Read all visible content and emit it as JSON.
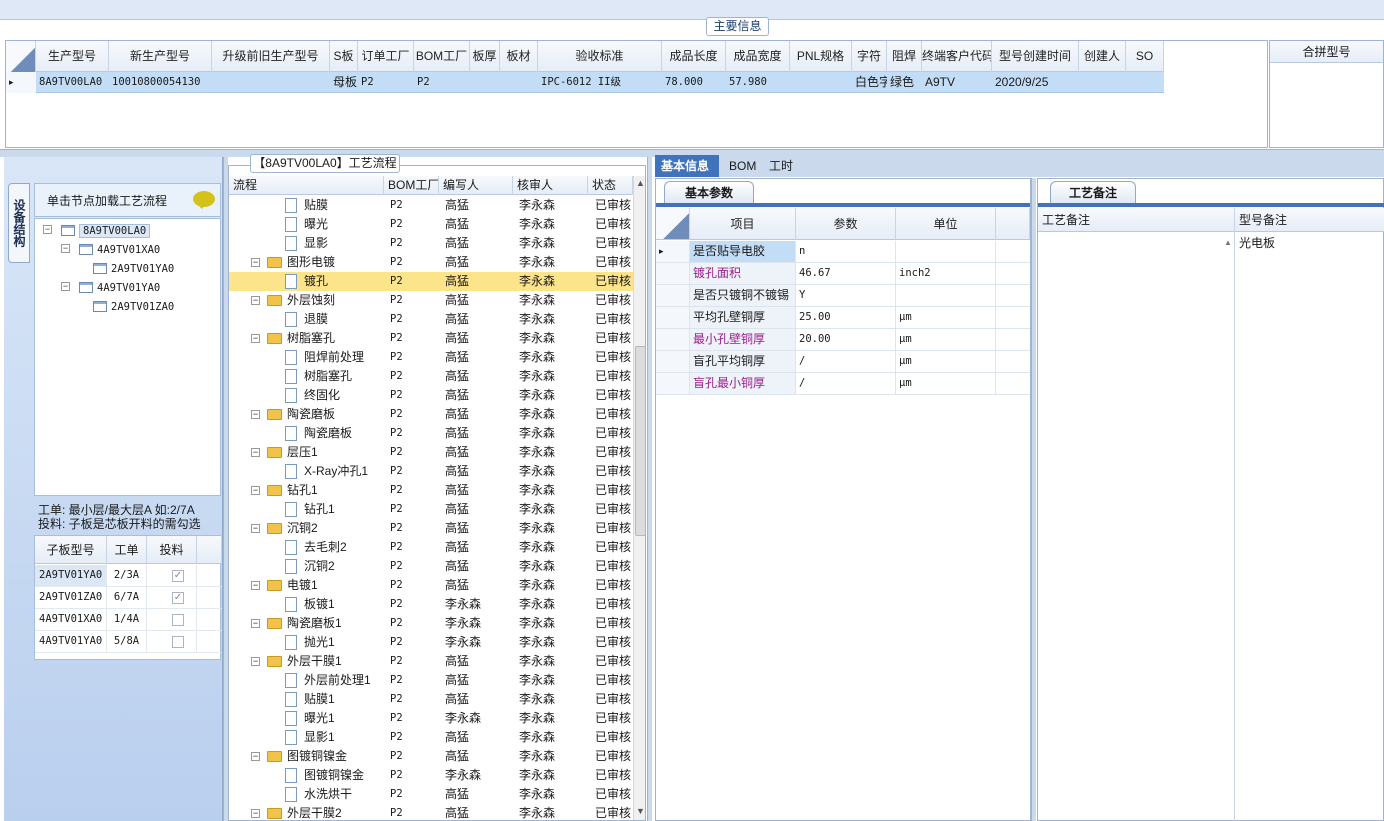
{
  "main": {
    "title": "主要信息",
    "columns": [
      "生产型号",
      "新生产型号",
      "升级前旧生产型号",
      "S板",
      "订单工厂",
      "BOM工厂",
      "板厚",
      "板材",
      "验收标准",
      "成品长度",
      "成品宽度",
      "PNL规格",
      "字符",
      "阻焊",
      "终端客户代码",
      "型号创建时间",
      "创建人",
      "SO"
    ],
    "row": [
      "8A9TV00LA0",
      "10010800054130",
      "",
      "母板",
      "P2",
      "P2",
      "",
      "",
      "IPC-6012 II级",
      "78.000",
      "57.980",
      "",
      "白色字符",
      "绿色",
      "A9TV",
      "2020/9/25",
      "",
      ""
    ],
    "row_marker": "▸",
    "merge_header": "合拼型号"
  },
  "left": {
    "vtab_label": "设备结构",
    "hint": "单击节点加载工艺流程",
    "tree": [
      {
        "label": "8A9TV00LA0",
        "level": 0
      },
      {
        "label": "4A9TV01XA0",
        "level": 1
      },
      {
        "label": "2A9TV01YA0",
        "level": 2
      },
      {
        "label": "4A9TV01YA0",
        "level": 1
      },
      {
        "label": "2A9TV01ZA0",
        "level": 2
      }
    ],
    "note_line1": "工单: 最小层/最大层A 如:2/7A",
    "note_line2": "投料: 子板是芯板开料的需勾选",
    "subgrid": {
      "headers": [
        "子板型号",
        "工单",
        "投料"
      ],
      "rows": [
        {
          "model": "2A9TV01YA0",
          "order": "2/3A",
          "checked": true
        },
        {
          "model": "2A9TV01ZA0",
          "order": "6/7A",
          "checked": true
        },
        {
          "model": "4A9TV01XA0",
          "order": "1/4A",
          "checked": false
        },
        {
          "model": "4A9TV01YA0",
          "order": "5/8A",
          "checked": false
        }
      ]
    }
  },
  "process": {
    "title": "【8A9TV00LA0】工艺流程",
    "headers": [
      "流程",
      "BOM工厂",
      "编写人",
      "核审人",
      "状态"
    ],
    "rows": [
      {
        "name": "贴膜",
        "level": 2,
        "bom": "P2",
        "writer": "高猛",
        "reviewer": "李永森",
        "status": "已审核"
      },
      {
        "name": "曝光",
        "level": 2,
        "bom": "P2",
        "writer": "高猛",
        "reviewer": "李永森",
        "status": "已审核"
      },
      {
        "name": "显影",
        "level": 2,
        "bom": "P2",
        "writer": "高猛",
        "reviewer": "李永森",
        "status": "已审核"
      },
      {
        "name": "图形电镀",
        "level": 1,
        "bom": "P2",
        "writer": "高猛",
        "reviewer": "李永森",
        "status": "已审核"
      },
      {
        "name": "镀孔",
        "level": 2,
        "bom": "P2",
        "writer": "高猛",
        "reviewer": "李永森",
        "status": "已审核",
        "selected": true
      },
      {
        "name": "外层蚀刻",
        "level": 1,
        "bom": "P2",
        "writer": "高猛",
        "reviewer": "李永森",
        "status": "已审核"
      },
      {
        "name": "退膜",
        "level": 2,
        "bom": "P2",
        "writer": "高猛",
        "reviewer": "李永森",
        "status": "已审核"
      },
      {
        "name": "树脂塞孔",
        "level": 1,
        "bom": "P2",
        "writer": "高猛",
        "reviewer": "李永森",
        "status": "已审核"
      },
      {
        "name": "阻焊前处理",
        "level": 2,
        "bom": "P2",
        "writer": "高猛",
        "reviewer": "李永森",
        "status": "已审核"
      },
      {
        "name": "树脂塞孔",
        "level": 2,
        "bom": "P2",
        "writer": "高猛",
        "reviewer": "李永森",
        "status": "已审核"
      },
      {
        "name": "终固化",
        "level": 2,
        "bom": "P2",
        "writer": "高猛",
        "reviewer": "李永森",
        "status": "已审核"
      },
      {
        "name": "陶瓷磨板",
        "level": 1,
        "bom": "P2",
        "writer": "高猛",
        "reviewer": "李永森",
        "status": "已审核"
      },
      {
        "name": "陶瓷磨板",
        "level": 2,
        "bom": "P2",
        "writer": "高猛",
        "reviewer": "李永森",
        "status": "已审核"
      },
      {
        "name": "层压1",
        "level": 1,
        "bom": "P2",
        "writer": "高猛",
        "reviewer": "李永森",
        "status": "已审核"
      },
      {
        "name": "X-Ray冲孔1",
        "level": 2,
        "bom": "P2",
        "writer": "高猛",
        "reviewer": "李永森",
        "status": "已审核"
      },
      {
        "name": "钻孔1",
        "level": 1,
        "bom": "P2",
        "writer": "高猛",
        "reviewer": "李永森",
        "status": "已审核"
      },
      {
        "name": "钻孔1",
        "level": 2,
        "bom": "P2",
        "writer": "高猛",
        "reviewer": "李永森",
        "status": "已审核"
      },
      {
        "name": "沉铜2",
        "level": 1,
        "bom": "P2",
        "writer": "高猛",
        "reviewer": "李永森",
        "status": "已审核"
      },
      {
        "name": "去毛刺2",
        "level": 2,
        "bom": "P2",
        "writer": "高猛",
        "reviewer": "李永森",
        "status": "已审核"
      },
      {
        "name": "沉铜2",
        "level": 2,
        "bom": "P2",
        "writer": "高猛",
        "reviewer": "李永森",
        "status": "已审核"
      },
      {
        "name": "电镀1",
        "level": 1,
        "bom": "P2",
        "writer": "高猛",
        "reviewer": "李永森",
        "status": "已审核"
      },
      {
        "name": "板镀1",
        "level": 2,
        "bom": "P2",
        "writer": "李永森",
        "reviewer": "李永森",
        "status": "已审核"
      },
      {
        "name": "陶瓷磨板1",
        "level": 1,
        "bom": "P2",
        "writer": "李永森",
        "reviewer": "李永森",
        "status": "已审核"
      },
      {
        "name": "抛光1",
        "level": 2,
        "bom": "P2",
        "writer": "李永森",
        "reviewer": "李永森",
        "status": "已审核"
      },
      {
        "name": "外层干膜1",
        "level": 1,
        "bom": "P2",
        "writer": "高猛",
        "reviewer": "李永森",
        "status": "已审核"
      },
      {
        "name": "外层前处理1",
        "level": 2,
        "bom": "P2",
        "writer": "高猛",
        "reviewer": "李永森",
        "status": "已审核"
      },
      {
        "name": "贴膜1",
        "level": 2,
        "bom": "P2",
        "writer": "高猛",
        "reviewer": "李永森",
        "status": "已审核"
      },
      {
        "name": "曝光1",
        "level": 2,
        "bom": "P2",
        "writer": "李永森",
        "reviewer": "李永森",
        "status": "已审核"
      },
      {
        "name": "显影1",
        "level": 2,
        "bom": "P2",
        "writer": "高猛",
        "reviewer": "李永森",
        "status": "已审核"
      },
      {
        "name": "图镀铜镍金",
        "level": 1,
        "bom": "P2",
        "writer": "高猛",
        "reviewer": "李永森",
        "status": "已审核"
      },
      {
        "name": "图镀铜镍金",
        "level": 2,
        "bom": "P2",
        "writer": "李永森",
        "reviewer": "李永森",
        "status": "已审核"
      },
      {
        "name": "水洗烘干",
        "level": 2,
        "bom": "P2",
        "writer": "高猛",
        "reviewer": "李永森",
        "status": "已审核"
      },
      {
        "name": "外层干膜2",
        "level": 1,
        "bom": "P2",
        "writer": "高猛",
        "reviewer": "李永森",
        "status": "已审核"
      }
    ]
  },
  "right": {
    "tabs": [
      "基本信息",
      "BOM",
      "工时"
    ],
    "basic_tab": "基本参数",
    "param_headers": [
      "项目",
      "参数",
      "单位"
    ],
    "params": [
      {
        "item": "是否贴导电胶",
        "value": "n",
        "unit": "",
        "highlight": false
      },
      {
        "item": "镀孔面积",
        "value": "46.67",
        "unit": "inch2",
        "highlight": true
      },
      {
        "item": "是否只镀铜不镀锡",
        "value": "Y",
        "unit": "",
        "highlight": false
      },
      {
        "item": "平均孔壁铜厚",
        "value": "25.00",
        "unit": "μm",
        "highlight": false
      },
      {
        "item": "最小孔壁铜厚",
        "value": "20.00",
        "unit": "μm",
        "highlight": true
      },
      {
        "item": "盲孔平均铜厚",
        "value": "/",
        "unit": "μm",
        "highlight": false
      },
      {
        "item": "盲孔最小铜厚",
        "value": "/",
        "unit": "μm",
        "highlight": true
      }
    ],
    "remark_tab": "工艺备注",
    "remark_headers": [
      "工艺备注",
      "型号备注"
    ],
    "model_remark": "光电板"
  }
}
